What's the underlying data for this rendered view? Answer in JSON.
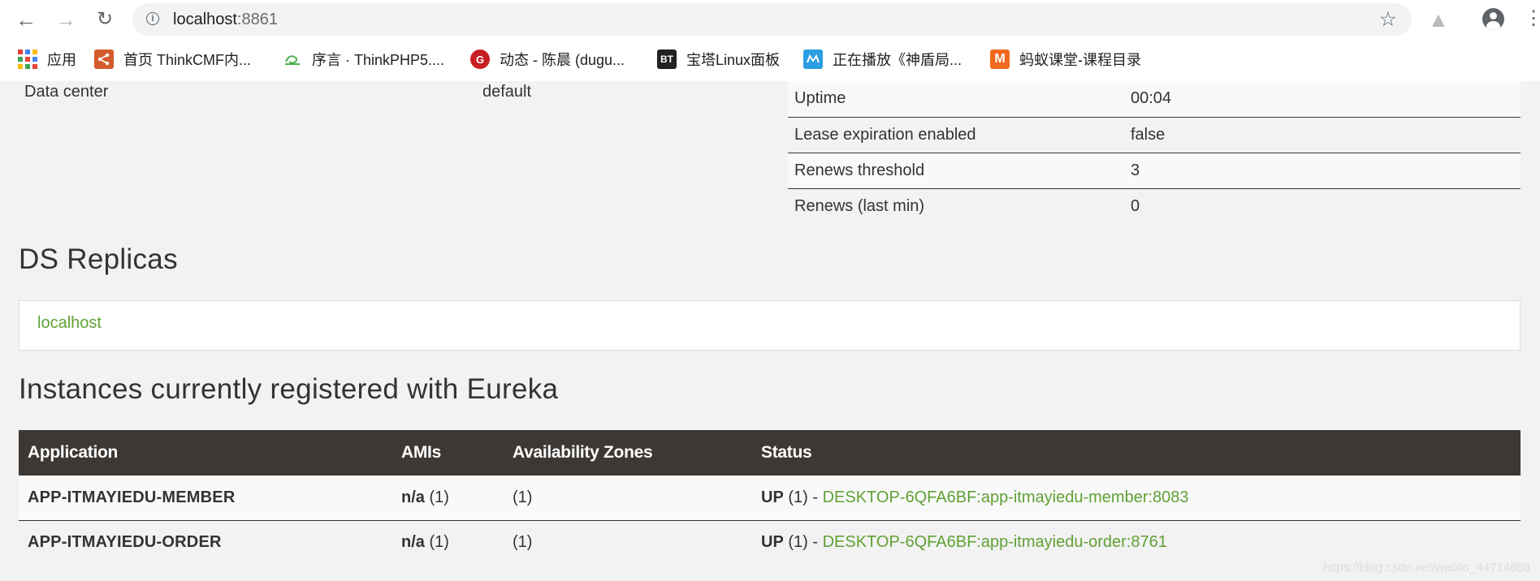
{
  "browser": {
    "url_host": "localhost",
    "url_port": ":8861",
    "bookmarks": [
      {
        "label": "应用",
        "icon": "apps-grid-icon"
      },
      {
        "label": "首页 ThinkCMF内...",
        "icon": "thinkcmf-icon",
        "color": "#d35a2b"
      },
      {
        "label": "序言 · ThinkPHP5....",
        "icon": "thinkphp-icon",
        "color": "#4caf50"
      },
      {
        "label": "动态 - 陈晨 (dugu...",
        "icon": "gitee-icon",
        "color": "#c71d23"
      },
      {
        "label": "宝塔Linux面板",
        "icon": "bt-icon",
        "icon_text": "BT",
        "color": "#222222"
      },
      {
        "label": "正在播放《神盾局...",
        "icon": "video-site-icon",
        "color": "#2b9de0"
      },
      {
        "label": "蚂蚁课堂-课程目录",
        "icon": "mayi-icon",
        "icon_text": "M",
        "color": "#f06a1d"
      }
    ]
  },
  "general_info": {
    "left": {
      "label": "Data center",
      "value": "default"
    },
    "rows": [
      {
        "label": "Uptime",
        "value": "00:04"
      },
      {
        "label": "Lease expiration enabled",
        "value": "false"
      },
      {
        "label": "Renews threshold",
        "value": "3"
      },
      {
        "label": "Renews (last min)",
        "value": "0"
      }
    ]
  },
  "replicas": {
    "title": "DS Replicas",
    "items": [
      "localhost"
    ]
  },
  "instances": {
    "title": "Instances currently registered with Eureka",
    "columns": [
      "Application",
      "AMIs",
      "Availability Zones",
      "Status"
    ],
    "rows": [
      {
        "app": "APP-ITMAYIEDU-MEMBER",
        "amis": "n/a",
        "amis_count": "(1)",
        "zones": "(1)",
        "status": "UP",
        "status_count": "(1) -",
        "instance": "DESKTOP-6QFA6BF:app-itmayiedu-member:8083"
      },
      {
        "app": "APP-ITMAYIEDU-ORDER",
        "amis": "n/a",
        "amis_count": "(1)",
        "zones": "(1)",
        "status": "UP",
        "status_count": "(1) -",
        "instance": "DESKTOP-6QFA6BF:app-itmayiedu-order:8761"
      }
    ]
  },
  "watermark": "https://blog.csdn.net/weixin_44714808",
  "colors": {
    "accent_link": "#5fa134",
    "table_header": "#3d3834"
  }
}
